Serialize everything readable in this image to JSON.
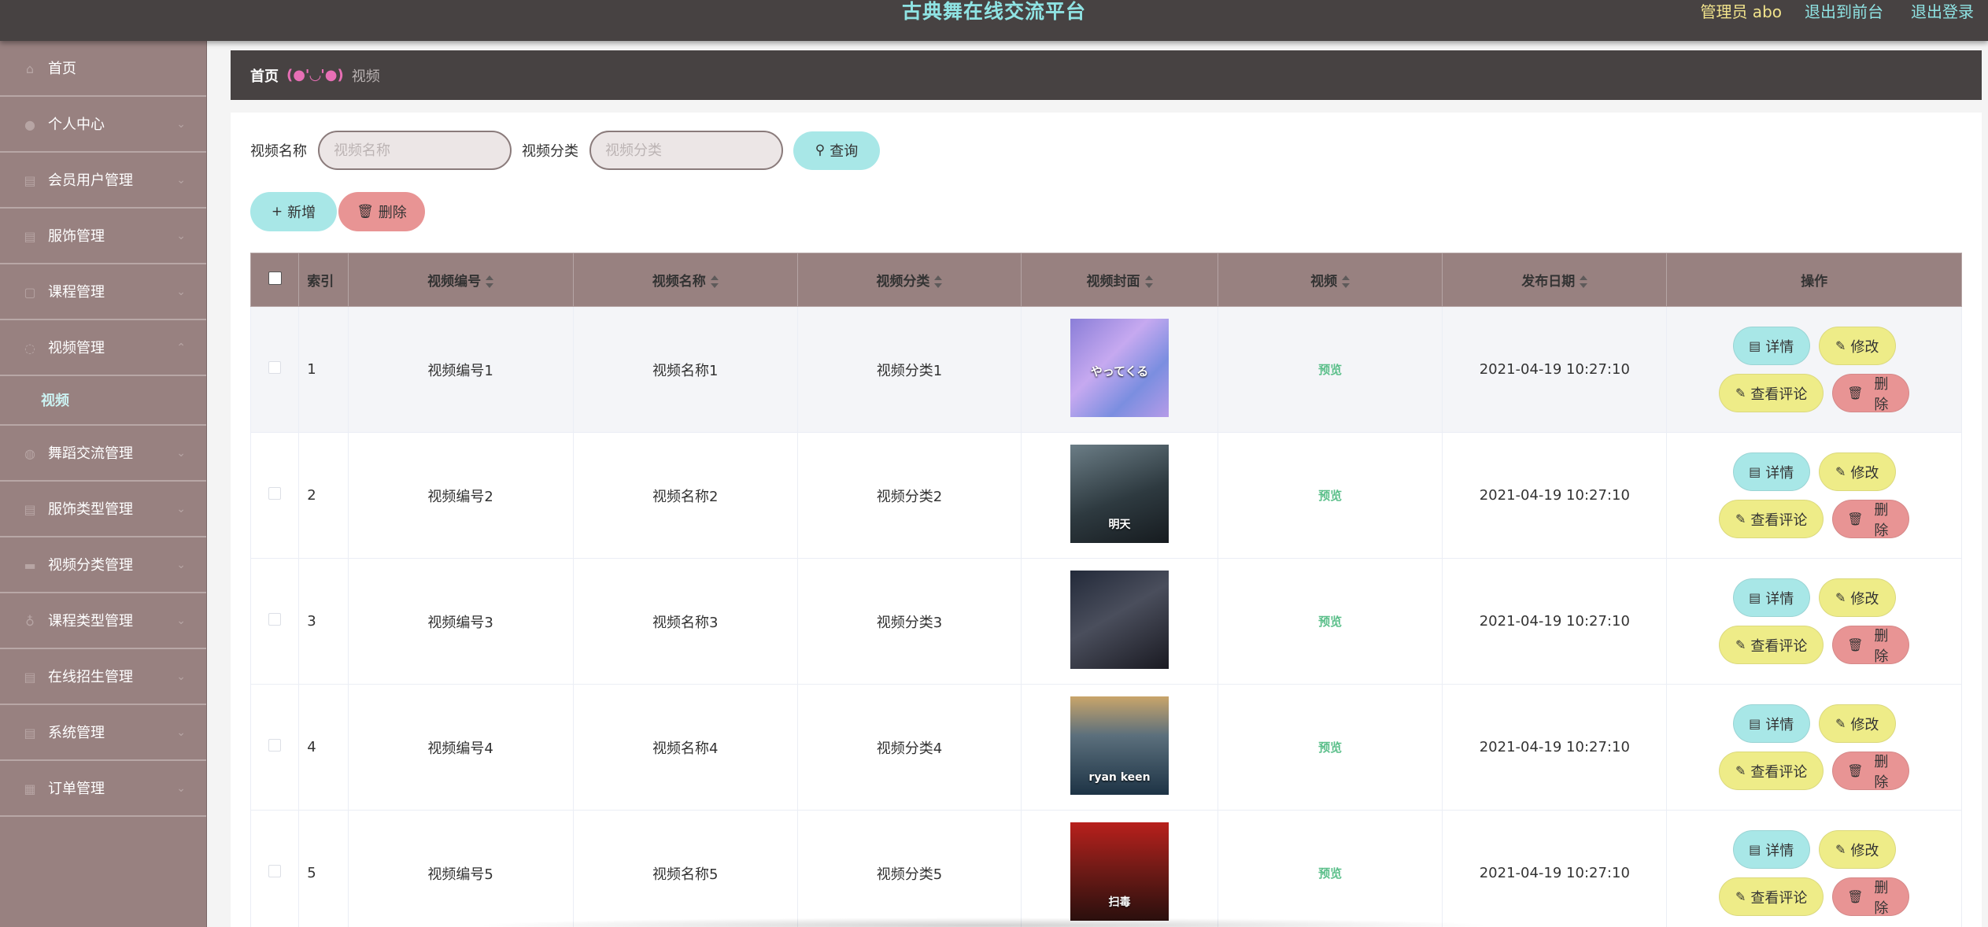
{
  "header": {
    "title": "古典舞在线交流平台",
    "admin_label": "管理员 abo",
    "front_link": "退出到前台",
    "logout_link": "退出登录"
  },
  "sidebar": {
    "items": [
      {
        "label": "首页",
        "icon": "home-icon"
      },
      {
        "label": "个人中心",
        "icon": "user-icon"
      },
      {
        "label": "会员用户管理",
        "icon": "list-icon"
      },
      {
        "label": "服饰管理",
        "icon": "list-icon"
      },
      {
        "label": "课程管理",
        "icon": "list-icon"
      },
      {
        "label": "视频管理",
        "icon": "list-icon"
      },
      {
        "label": "舞蹈交流管理",
        "icon": "list-icon"
      },
      {
        "label": "服饰类型管理",
        "icon": "list-icon"
      },
      {
        "label": "视频分类管理",
        "icon": "list-icon"
      },
      {
        "label": "课程类型管理",
        "icon": "list-icon"
      },
      {
        "label": "在线招生管理",
        "icon": "list-icon"
      },
      {
        "label": "系统管理",
        "icon": "list-icon"
      },
      {
        "label": "订单管理",
        "icon": "list-icon"
      }
    ],
    "submenu_video": "视频"
  },
  "breadcrumb": {
    "home": "首页",
    "separator": "(●'◡'●)",
    "current": "视频"
  },
  "search": {
    "name_label": "视频名称",
    "name_placeholder": "视频名称",
    "category_label": "视频分类",
    "category_placeholder": "视频分类",
    "query_button": "查询"
  },
  "actions": {
    "add_button": "新增",
    "delete_button": "删除"
  },
  "table": {
    "columns": [
      "索引",
      "视频编号",
      "视频名称",
      "视频分类",
      "视频封面",
      "视频",
      "发布日期",
      "操作"
    ],
    "preview_label": "预览",
    "op_labels": {
      "detail": "详情",
      "edit": "修改",
      "comment": "查看评论",
      "delete": "删除"
    },
    "rows": [
      {
        "index": "1",
        "code": "视频编号1",
        "name": "视频名称1",
        "category": "视频分类1",
        "date": "2021-04-19 10:27:10",
        "cover_text": "やってくる"
      },
      {
        "index": "2",
        "code": "视频编号2",
        "name": "视频名称2",
        "category": "视频分类2",
        "date": "2021-04-19 10:27:10",
        "cover_text": "明天"
      },
      {
        "index": "3",
        "code": "视频编号3",
        "name": "视频名称3",
        "category": "视频分类3",
        "date": "2021-04-19 10:27:10",
        "cover_text": ""
      },
      {
        "index": "4",
        "code": "视频编号4",
        "name": "视频名称4",
        "category": "视频分类4",
        "date": "2021-04-19 10:27:10",
        "cover_text": "ryan keen"
      },
      {
        "index": "5",
        "code": "视频编号5",
        "name": "视频名称5",
        "category": "视频分类5",
        "date": "2021-04-19 10:27:10",
        "cover_text": "扫毒"
      }
    ]
  },
  "colors": {
    "topbar": "#474242",
    "sidebar": "#988180",
    "accent_cyan": "#a8e7e7",
    "accent_yellow": "#eeec88",
    "accent_red": "#e89494",
    "preview_green": "#5bbf8a"
  }
}
